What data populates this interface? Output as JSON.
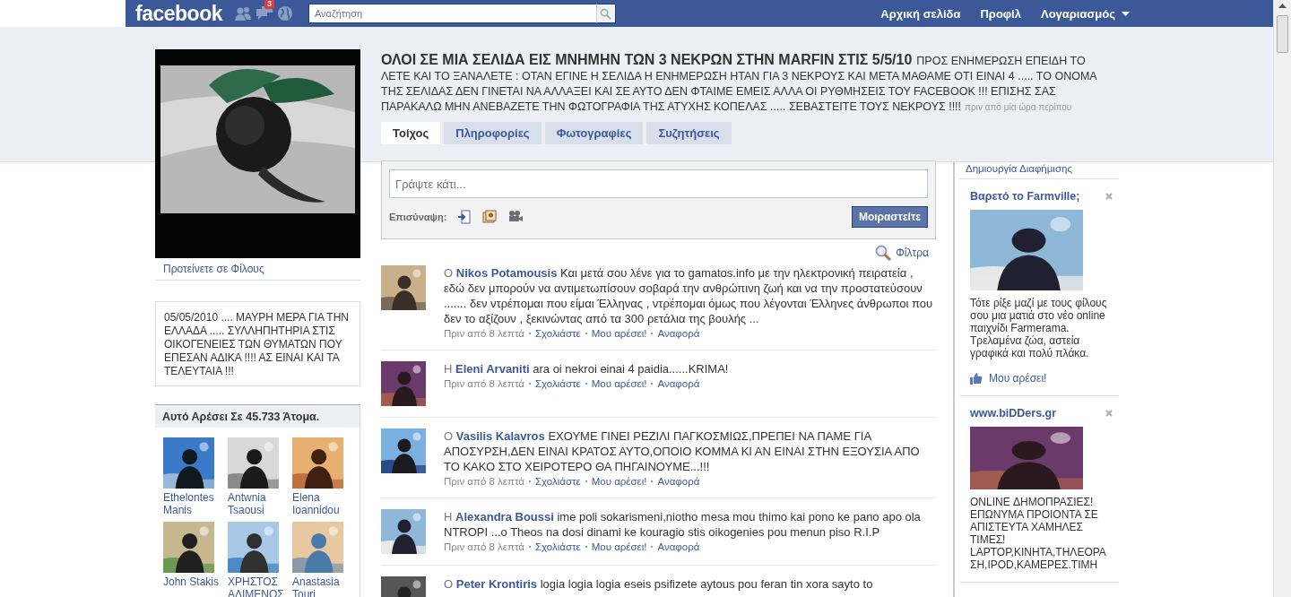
{
  "top_bar": {
    "logo": "facebook",
    "notification_badge": "3",
    "search": {
      "placeholder": "Αναζήτηση"
    },
    "nav": [
      {
        "label": "Αρχική σελίδα",
        "dropdown": false
      },
      {
        "label": "Προφίλ",
        "dropdown": false
      },
      {
        "label": "Λογαριασμός",
        "dropdown": true
      }
    ]
  },
  "page": {
    "title": "ΟΛΟΙ ΣΕ ΜΙΑ ΣΕΛΙΔΑ ΕΙΣ ΜΝΗΜΗΝ ΤΩΝ 3 ΝΕΚΡΩΝ ΣΤΗΝ MARFIN ΣΤΙΣ 5/5/10",
    "status": "ΠΡΟΣ ΕΝΗΜΕΡΩΣΗ ΕΠΕΙΔΗ ΤΟ ΛΕΤΕ ΚΑΙ ΤΟ ΞΑΝΑΛΕΤΕ : ΟΤΑΝ ΕΓΙΝΕ Η ΣΕΛΙΔΑ Η ΕΝΗΜΕΡΩΣΗ ΗΤΑΝ ΓΙΑ 3 ΝΕΚΡΟΥΣ ΚΑΙ ΜΕΤΑ ΜΑΘΑΜΕ ΟΤΙ ΕΙΝΑΙ 4 ..... ΤΟ ΟΝΟΜΑ ΤΗΣ ΣΕΛΙΔΑΣ ΔΕΝ ΓΙΝΕΤΑΙ ΝΑ ΑΛΛΑΞΕΙ ΚΑΙ ΣΕ ΑΥΤΟ ΔΕΝ ΦΤΑΙΜΕ ΕΜΕΙΣ ΑΛΛΑ ΟΙ ΡΥΘΜΗΣΕΙΣ ΤΟΥ FACEBOOK !!! ΕΠΙΣΗΣ ΣΑΣ ΠΑΡΑΚΑΛΩ ΜΗΝ ΑΝΕΒΑΖΕΤΕ ΤΗΝ ΦΩΤΟΓΡΑΦΙΑ ΤΗΣ ΑΤΥΧΗΣ ΚΟΠΕΛΑΣ ..... ΣΕΒΑΣΤΕΙΤΕ ΤΟΥΣ ΝΕΚΡΟΥΣ !!!!",
    "time": "πριν από μία ώρα περίπου"
  },
  "sidebar": {
    "suggest_link": "Προτείνετε σε Φίλους",
    "info": "05/05/2010 .... ΜΑΥΡΗ ΜΕΡΑ ΓΙΑ ΤΗΝ ΕΛΛΑΔΑ ..... ΣΥΛΛΗΠΗΤΗΡΙΑ ΣΤΙΣ ΟΙΚΟΓΕΝΕΙΕΣ ΤΩΝ ΘΥΜΑΤΩΝ ΠΟΥ ΕΠΕΣΑΝ ΑΔΙΚΑ !!!! ΑΣ ΕΙΝΑΙ ΚΑΙ ΤΑ ΤΕΛΕΥΤΑΙΑ !!!",
    "likes": {
      "title": "Αυτό Αρέσει Σε 45.733 Άτομα.",
      "people": [
        {
          "name": "Ethelontes Manis"
        },
        {
          "name": "Antwnia Tsaousi"
        },
        {
          "name": "Elena Ioannidou"
        },
        {
          "name": "John Stakis"
        },
        {
          "name": "ΧΡΗΣΤΟΣ ΑΛΙΜΕΝΟΣ"
        },
        {
          "name": "Anastasia Touri"
        }
      ]
    }
  },
  "tabs": [
    {
      "label": "Τοίχος",
      "selected": true
    },
    {
      "label": "Πληροφορίες",
      "selected": false
    },
    {
      "label": "Φωτογραφίες",
      "selected": false
    },
    {
      "label": "Συζητήσεις",
      "selected": false
    }
  ],
  "composer": {
    "placeholder": "Γράψτε κάτι...",
    "attach_label": "Επισύναψη:",
    "button": "Μοιραστείτε"
  },
  "filter": "Φίλτρα",
  "posts": [
    {
      "article": "Ο",
      "author": "Nikos Potamousis",
      "text": "Και μετά σου λένε για το gamatos.info με την ηλεκτρονική πειρατεία , εδώ δεν μπορούν να αντιμετωπίσουν σοβαρά την ανθρώπινη ζωή και να την προστατεύσουν ....... δεν ντρέπομαι που είμαι Έλληνας , ντρέπομαι όμως που λέγονται Έλληνες άνθρωποι που δεν το αξίζουν , ξεκινώντας από τα 300 ρετάλια της βουλής ...",
      "time": "Πριν από 8 λεπτά",
      "actions": [
        "Σχολιάστε",
        "Μου αρέσει!",
        "Αναφορά"
      ]
    },
    {
      "article": "Η",
      "author": "Eleni Arvaniti",
      "text": "ara oi nekroi einai 4 paidia......KRIMA!",
      "time": "Πριν από 8 λεπτά",
      "actions": [
        "Σχολιάστε",
        "Μου αρέσει!",
        "Αναφορά"
      ]
    },
    {
      "article": "Ο",
      "author": "Vasilis Kalavros",
      "text": "ΕΧΟΥΜΕ ΓΙΝΕΙ ΡΕΖΙΛΙ ΠΑΓΚΟΣΜΙΩΣ,ΠΡΕΠΕΙ ΝΑ ΠΑΜΕ ΓΙΑ ΑΠΟΣΥΡΣΗ,ΔΕΝ ΕΙΝΑΙ ΚΡΑΤΟΣ ΑΥΤΟ,ΟΠΟΙΟ ΚΟΜΜΑ ΚΙ ΑΝ ΕΙΝΑΙ ΣΤΗΝ ΕΞΟΥΣΙΑ ΑΠΟ ΤΟ ΚΑΚΟ ΣΤΟ ΧΕΙΡΟΤΕΡΟ ΘΑ ΠΗΓΑΙΝΟΥΜΕ...!!!",
      "time": "Πριν από 8 λεπτά",
      "actions": [
        "Σχολιάστε",
        "Μου αρέσει!",
        "Αναφορά"
      ]
    },
    {
      "article": "Η",
      "author": "Alexandra Boussi",
      "text": "ime poli sokarismeni,niotho mesa mou thimo kai pono ke pano apo ola NTROPI ...o Theos na dosi dinami ke kouragio stis oikogenies pou menun piso R.I.P",
      "time": "Πριν από 8 λεπτά",
      "actions": [
        "Σχολιάστε",
        "Μου αρέσει!",
        "Αναφορά"
      ]
    },
    {
      "article": "Ο",
      "author": "Peter Krontiris",
      "text": "logia logia logia eseis psifizete aytous pou feran tin xora sayto to"
    }
  ],
  "ads": {
    "create_link": "Δημιουργία Διαφήμισης",
    "items": [
      {
        "title": "Βαρετό το Farmville;",
        "text": "Τότε ρίξε μαζί με τους φίλους σου μια ματιά στο νέο online παιχνίδι Farmerama. Τρελαμένα ζώα, αστεία γραφικά και πολύ πλάκα.",
        "like": "Μου αρέσει!"
      },
      {
        "title": "www.biDDers.gr",
        "text": "ONLINE ΔΗΜΟΠΡΑΣΙΕΣ! ΕΠΩΝΥΜΑ ΠΡΟΙΟΝΤΑ ΣΕ ΑΠΙΣΤΕΥΤΑ ΧΑΜΗΛΕΣ ΤΙΜΕΣ! LAPTOP,ΚΙΝΗΤΑ,ΤΗΛΕΟΡΑΣΗ,IPOD,ΚΑΜΕΡΕΣ.ΤΙΜΗ"
      }
    ]
  }
}
